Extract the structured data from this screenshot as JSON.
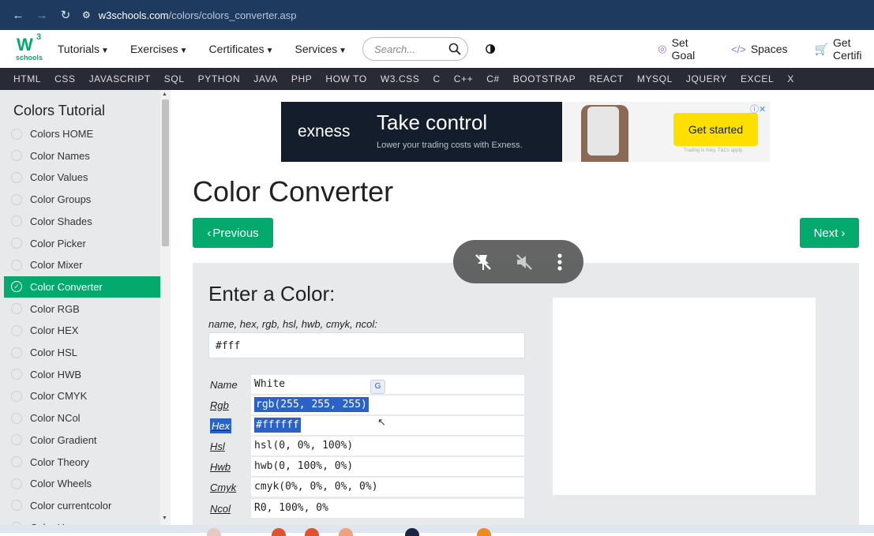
{
  "browser": {
    "url_host": "w3schools.com",
    "url_path": "/colors/colors_converter.asp"
  },
  "topnav": {
    "logo_main": "W",
    "logo_sup": "3",
    "logo_sub": "schools",
    "menus": [
      "Tutorials",
      "Exercises",
      "Certificates",
      "Services"
    ],
    "search_placeholder": "Search...",
    "set_goal": "Set Goal",
    "spaces": "Spaces",
    "get_certified": "Get Certifi"
  },
  "subnav": [
    "HTML",
    "CSS",
    "JAVASCRIPT",
    "SQL",
    "PYTHON",
    "JAVA",
    "PHP",
    "HOW TO",
    "W3.CSS",
    "C",
    "C++",
    "C#",
    "BOOTSTRAP",
    "REACT",
    "MYSQL",
    "JQUERY",
    "EXCEL",
    "X"
  ],
  "sidebar": {
    "title": "Colors Tutorial",
    "items": [
      "Colors HOME",
      "Color Names",
      "Color Values",
      "Color Groups",
      "Color Shades",
      "Color Picker",
      "Color Mixer",
      "Color Converter",
      "Color RGB",
      "Color HEX",
      "Color HSL",
      "Color HWB",
      "Color CMYK",
      "Color NCol",
      "Color Gradient",
      "Color Theory",
      "Color Wheels",
      "Color currentcolor",
      "Color Hues"
    ],
    "active_index": 7
  },
  "ad": {
    "brand": "exness",
    "headline": "Take control",
    "subline": "Lower your trading costs with Exness.",
    "cta": "Get started",
    "fine_print": "Trading is risky. T&Cs apply."
  },
  "main": {
    "title": "Color Converter",
    "prev_label": "Previous",
    "next_label": "Next",
    "enter_heading": "Enter a Color:",
    "input_hint": "name, hex, rgb, hsl, hwb, cmyk, ncol:",
    "input_value": "#fff",
    "rows": [
      {
        "label": "Name",
        "value": "White",
        "link": false
      },
      {
        "label": "Rgb",
        "value": "rgb(255, 255, 255)",
        "link": true
      },
      {
        "label": "Hex",
        "value": "#ffffff",
        "link": true
      },
      {
        "label": "Hsl",
        "value": "hsl(0, 0%, 100%)",
        "link": true
      },
      {
        "label": "Hwb",
        "value": "hwb(0, 100%, 0%)",
        "link": true
      },
      {
        "label": "Cmyk",
        "value": "cmyk(0%, 0%, 0%, 0%)",
        "link": true
      },
      {
        "label": "Ncol",
        "value": "R0, 100%, 0%",
        "link": true
      }
    ],
    "preview_color": "#ffffff"
  },
  "colors": {
    "accent": "#04aa6d",
    "subnav_bg": "#282a35",
    "selection": "#2b62c7"
  }
}
